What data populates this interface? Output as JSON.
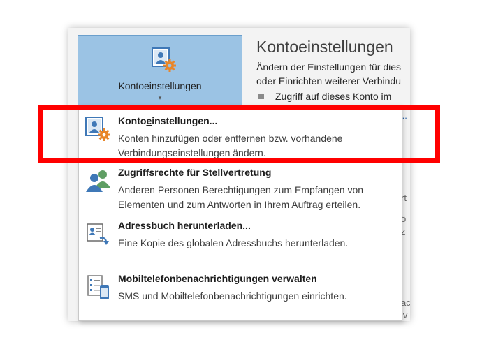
{
  "backstage": {
    "big_button": {
      "label": "Kontoeinstellungen",
      "arrow": "▾"
    },
    "panel": {
      "title": "Kontoeinstellungen",
      "desc_line1": "Ändern der Einstellungen für dies",
      "desc_line2": "oder Einrichten weiterer Verbindu",
      "bullet": "Zugriff auf dieses Konto im",
      "link_fragment": "..."
    },
    "edge_fragments": [
      "rt",
      "ö",
      "z",
      "ac",
      "iv"
    ]
  },
  "menu": {
    "items": [
      {
        "title_pre": "Konto",
        "title_key": "e",
        "title_post": "instellungen...",
        "desc": "Konten hinzufügen oder entfernen bzw. vorhandene Verbindungseinstellungen ändern.",
        "icon": "account-settings-icon"
      },
      {
        "title_pre": "",
        "title_key": "Z",
        "title_post": "ugriffsrechte für Stellvertretung",
        "desc": "Anderen Personen Berechtigungen zum Empfangen von Elementen und zum Antworten in Ihrem Auftrag erteilen.",
        "icon": "delegate-access-icon"
      },
      {
        "title_pre": "Adress",
        "title_key": "b",
        "title_post": "uch herunterladen...",
        "desc": "Eine Kopie des globalen Adressbuchs herunterladen.",
        "icon": "address-book-download-icon"
      },
      {
        "title_pre": "",
        "title_key": "M",
        "title_post": "obiltelefonbenachrichtigungen verwalten",
        "desc": "SMS und Mobiltelefonbenachrichtigungen einrichten.",
        "icon": "mobile-notifications-icon"
      }
    ]
  },
  "colors": {
    "button_bg": "#9bc3e4",
    "highlight": "#ff0000",
    "icon_blue": "#3f78b7",
    "icon_orange": "#e8862a",
    "icon_green": "#5f9e64"
  }
}
